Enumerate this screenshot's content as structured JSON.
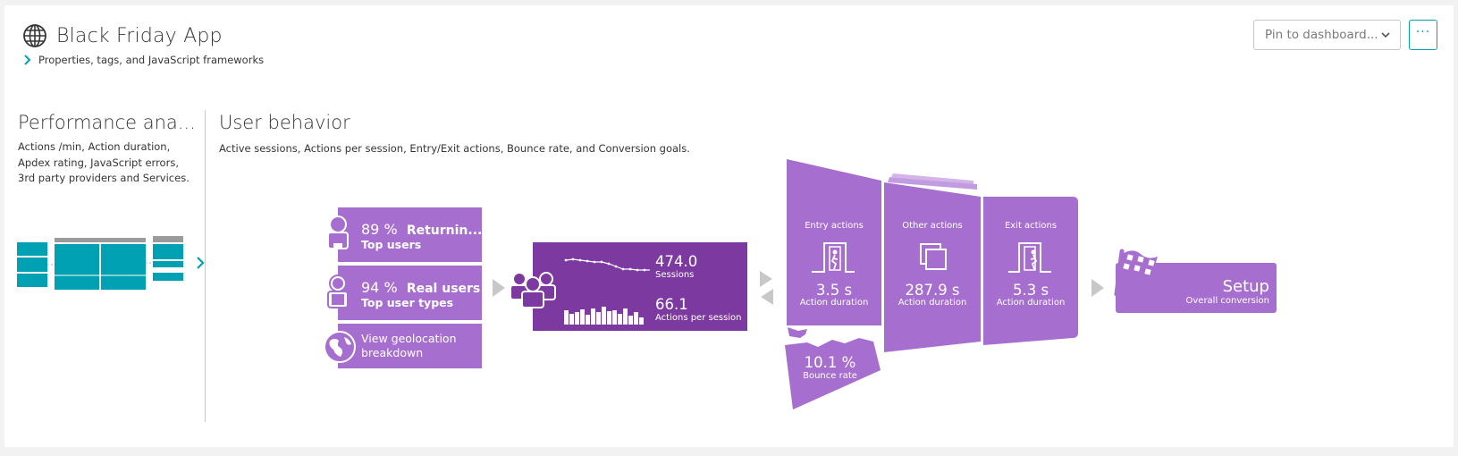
{
  "header": {
    "app_title": "Black Friday App",
    "properties_link": "Properties, tags, and JavaScript frameworks",
    "pin_label": "Pin to dashboard...",
    "more_label": "···"
  },
  "performance": {
    "title": "Performance ana...",
    "description": "Actions /min, Action duration, Apdex rating, JavaScript errors, 3rd party providers and Services."
  },
  "user_behavior": {
    "title": "User behavior",
    "description": "Active sessions, Actions per session, Entry/Exit actions, Bounce rate, and Conversion goals.",
    "returning": {
      "value": "89 %",
      "label": "Returnin...",
      "sub": "Top users"
    },
    "real_users": {
      "value": "94 %",
      "label": "Real users",
      "sub": "Top user types"
    },
    "geolocation": {
      "label_line1": "View geolocation",
      "label_line2": "breakdown"
    },
    "sessions": {
      "value": "474.0",
      "label": "Sessions"
    },
    "actions_per_session": {
      "value": "66.1",
      "label": "Actions per session"
    },
    "entry_actions": {
      "title": "Entry actions",
      "value": "3.5 s",
      "label": "Action duration"
    },
    "other_actions": {
      "title": "Other actions",
      "value": "287.9 s",
      "label": "Action duration"
    },
    "exit_actions": {
      "title": "Exit actions",
      "value": "5.3 s",
      "label": "Action duration"
    },
    "bounce": {
      "value": "10.1 %",
      "label": "Bounce rate"
    },
    "conversion": {
      "value": "Setup",
      "label": "Overall conversion"
    }
  },
  "colors": {
    "accent": "#00a1b2",
    "tile_purple": "#a66fcf",
    "tile_dark_purple": "#7c3aa0",
    "teal_map": "#00a1b2"
  }
}
